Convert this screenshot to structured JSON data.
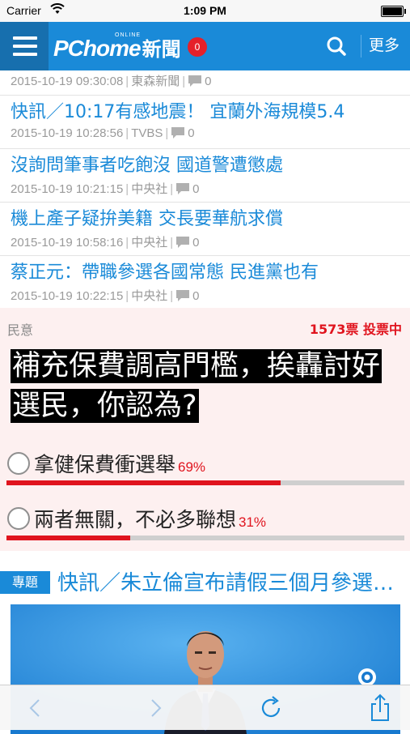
{
  "status_bar": {
    "carrier": "Carrier",
    "time": "1:09 PM"
  },
  "header": {
    "brand_online": "ONLINE",
    "brand": "PChome",
    "brand_suffix": "新聞",
    "notification_count": "0",
    "more_label": "更多"
  },
  "news": [
    {
      "title": "",
      "date": "2015-10-19 09:30:08",
      "source": "東森新聞",
      "comments": "0"
    },
    {
      "title": "快訊／10:17有感地震！ 宜蘭外海規模5.4",
      "date": "2015-10-19 10:28:56",
      "source": "TVBS",
      "comments": "0"
    },
    {
      "title": "沒詢問筆事者吃飽沒 國道警遭懲處",
      "date": "2015-10-19 10:21:15",
      "source": "中央社",
      "comments": "0"
    },
    {
      "title": "機上產子疑拚美籍 交長要華航求償",
      "date": "2015-10-19 10:58:16",
      "source": "中央社",
      "comments": "0"
    },
    {
      "title": "蔡正元：帶職參選各國常態 民進黨也有",
      "date": "2015-10-19 10:22:15",
      "source": "中央社",
      "comments": "0"
    }
  ],
  "poll": {
    "label": "民意",
    "votes": "1573票 投票中",
    "question": "補充保費調高門檻，挨轟討好選民，你認為?",
    "options": [
      {
        "text": "拿健保費衝選舉",
        "percent_label": "69%",
        "percent": 69
      },
      {
        "text": "兩者無關，不必多聯想",
        "percent_label": "31%",
        "percent": 31
      }
    ]
  },
  "topic": {
    "badge": "專題",
    "title": "快訊／朱立倫宣布請假三個月參選總統"
  },
  "colors": {
    "accent_blue": "#1a8ad8",
    "header_dark": "#176fae",
    "poll_red": "#e0141e",
    "poll_bg": "#fdf0f0"
  },
  "icons": {
    "menu": "hamburger-icon",
    "search": "search-icon",
    "comment": "comment-icon",
    "back": "chevron-left-icon",
    "forward": "chevron-right-icon",
    "reload": "reload-icon",
    "share": "share-icon"
  }
}
